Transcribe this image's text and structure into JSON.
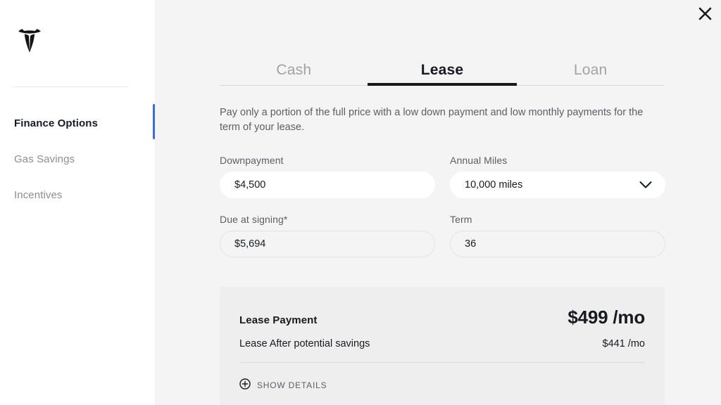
{
  "window": {
    "close_icon": "close-icon"
  },
  "sidebar": {
    "logo": "tesla-logo",
    "items": [
      {
        "label": "Finance Options",
        "active": true
      },
      {
        "label": "Gas Savings",
        "active": false
      },
      {
        "label": "Incentives",
        "active": false
      }
    ],
    "active_indicator_color": "#3e6ae1"
  },
  "main": {
    "tabs": [
      {
        "label": "Cash",
        "active": false
      },
      {
        "label": "Lease",
        "active": true
      },
      {
        "label": "Loan",
        "active": false
      }
    ],
    "description": "Pay only a portion of the full price with a low down payment and low monthly payments for the term of your lease.",
    "fields": {
      "downpayment": {
        "label": "Downpayment",
        "value": "$4,500",
        "placeholder": "$4,500"
      },
      "annual_miles": {
        "label": "Annual Miles",
        "value": "10,000 miles",
        "chevron_icon": "chevron-down-icon"
      },
      "due_at_signing": {
        "label": "Due at signing*",
        "value": "$5,694",
        "placeholder": "$5,694"
      },
      "term": {
        "label": "Term",
        "value": "36",
        "placeholder": "36"
      }
    },
    "summary": {
      "payment_label": "Lease Payment",
      "payment_value": "$499 /mo",
      "savings_label": "Lease After potential savings",
      "savings_value": "$441 /mo",
      "show_details_label": "SHOW DETAILS",
      "show_details_icon": "plus-circle-icon"
    }
  }
}
